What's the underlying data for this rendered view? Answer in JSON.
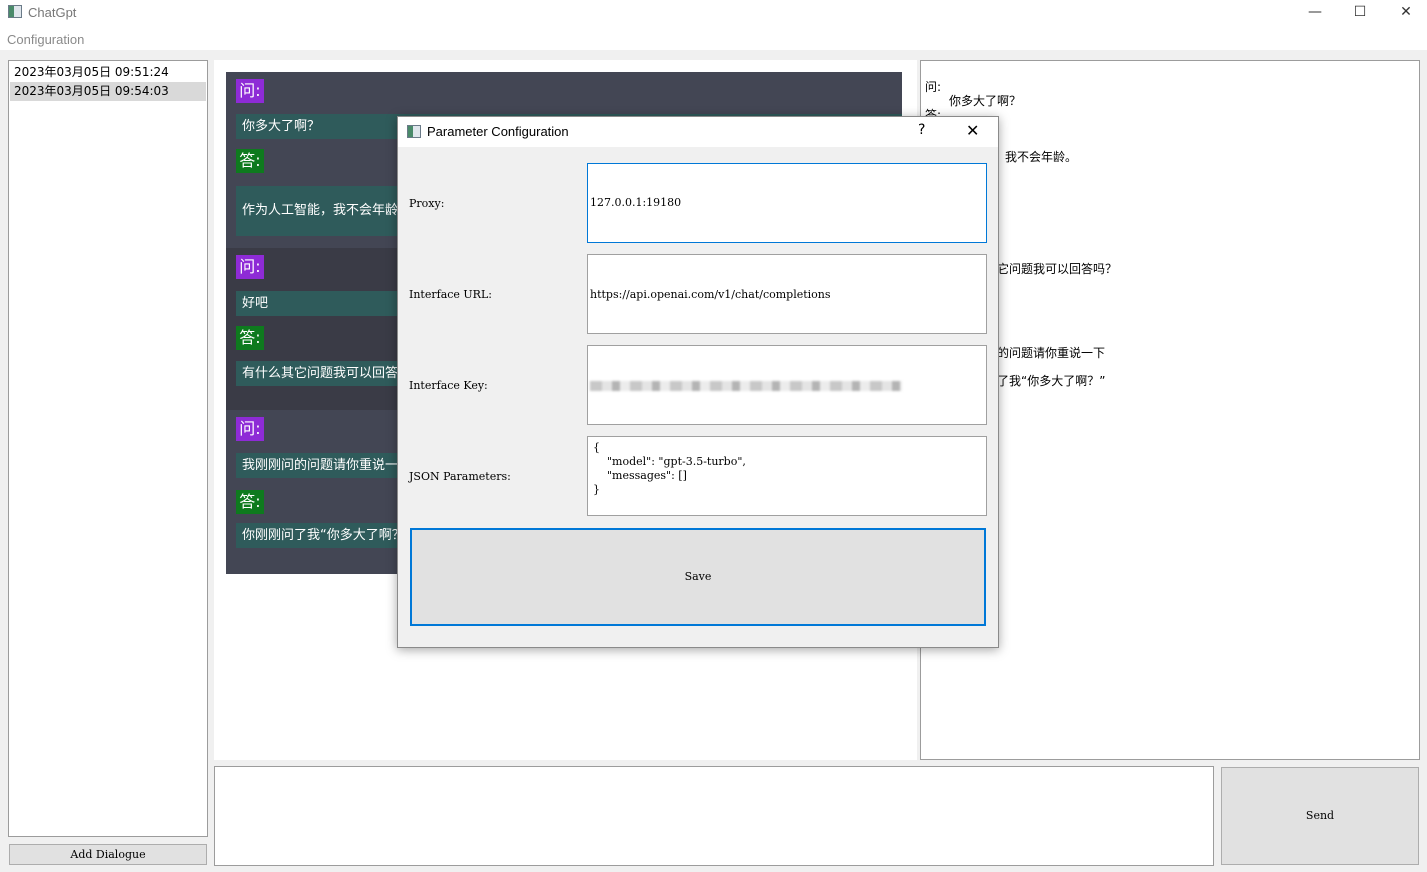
{
  "window": {
    "title": "ChatGpt",
    "minimize": "—",
    "maximize": "☐",
    "close": "✕"
  },
  "menu": {
    "configuration": "Configuration"
  },
  "sessions": [
    {
      "label": "2023年03月05日 09:51:24"
    },
    {
      "label": "2023年03月05日 09:54:03"
    }
  ],
  "add_dialogue_label": "Add Dialogue",
  "chat": {
    "q_tag": "问:",
    "a_tag": "答:",
    "messages": [
      {
        "question": "你多大了啊？",
        "answer": "作为人工智能，我不会年龄"
      },
      {
        "question": "好吧",
        "answer": "有什么其它问题我可以回答"
      },
      {
        "question": "我刚刚问的问题请你重说一",
        "answer": "你刚刚问了我“你多大了啊？"
      }
    ]
  },
  "right_panel": {
    "q_label": "问:",
    "a_label": "答:",
    "line_question": "你多大了啊？",
    "line_answer_1": "，我不会年龄。",
    "line_answer_2": "它问题我可以回答吗？",
    "line_answer_3": "的问题请你重说一下",
    "line_answer_4": "了我“你多大了啊？”"
  },
  "send_label": "Send",
  "dialog": {
    "title": "Parameter Configuration",
    "help": "?",
    "close": "✕",
    "proxy_label": "Proxy:",
    "proxy_value": "127.0.0.1:19180",
    "url_label": "Interface URL:",
    "url_value": "https://api.openai.com/v1/chat/completions",
    "key_label": "Interface Key:",
    "json_label": "JSON Parameters:",
    "json_value": "{\n    \"model\": \"gpt-3.5-turbo\",\n    \"messages\": []\n}",
    "save_label": "Save"
  },
  "colors": {
    "question_tag": "#8e2bd6",
    "answer_tag": "#0e7a1e",
    "bubble": "#2f5b5b",
    "chat_block_dark": "#3c3f4a",
    "focus": "#0078d7"
  }
}
